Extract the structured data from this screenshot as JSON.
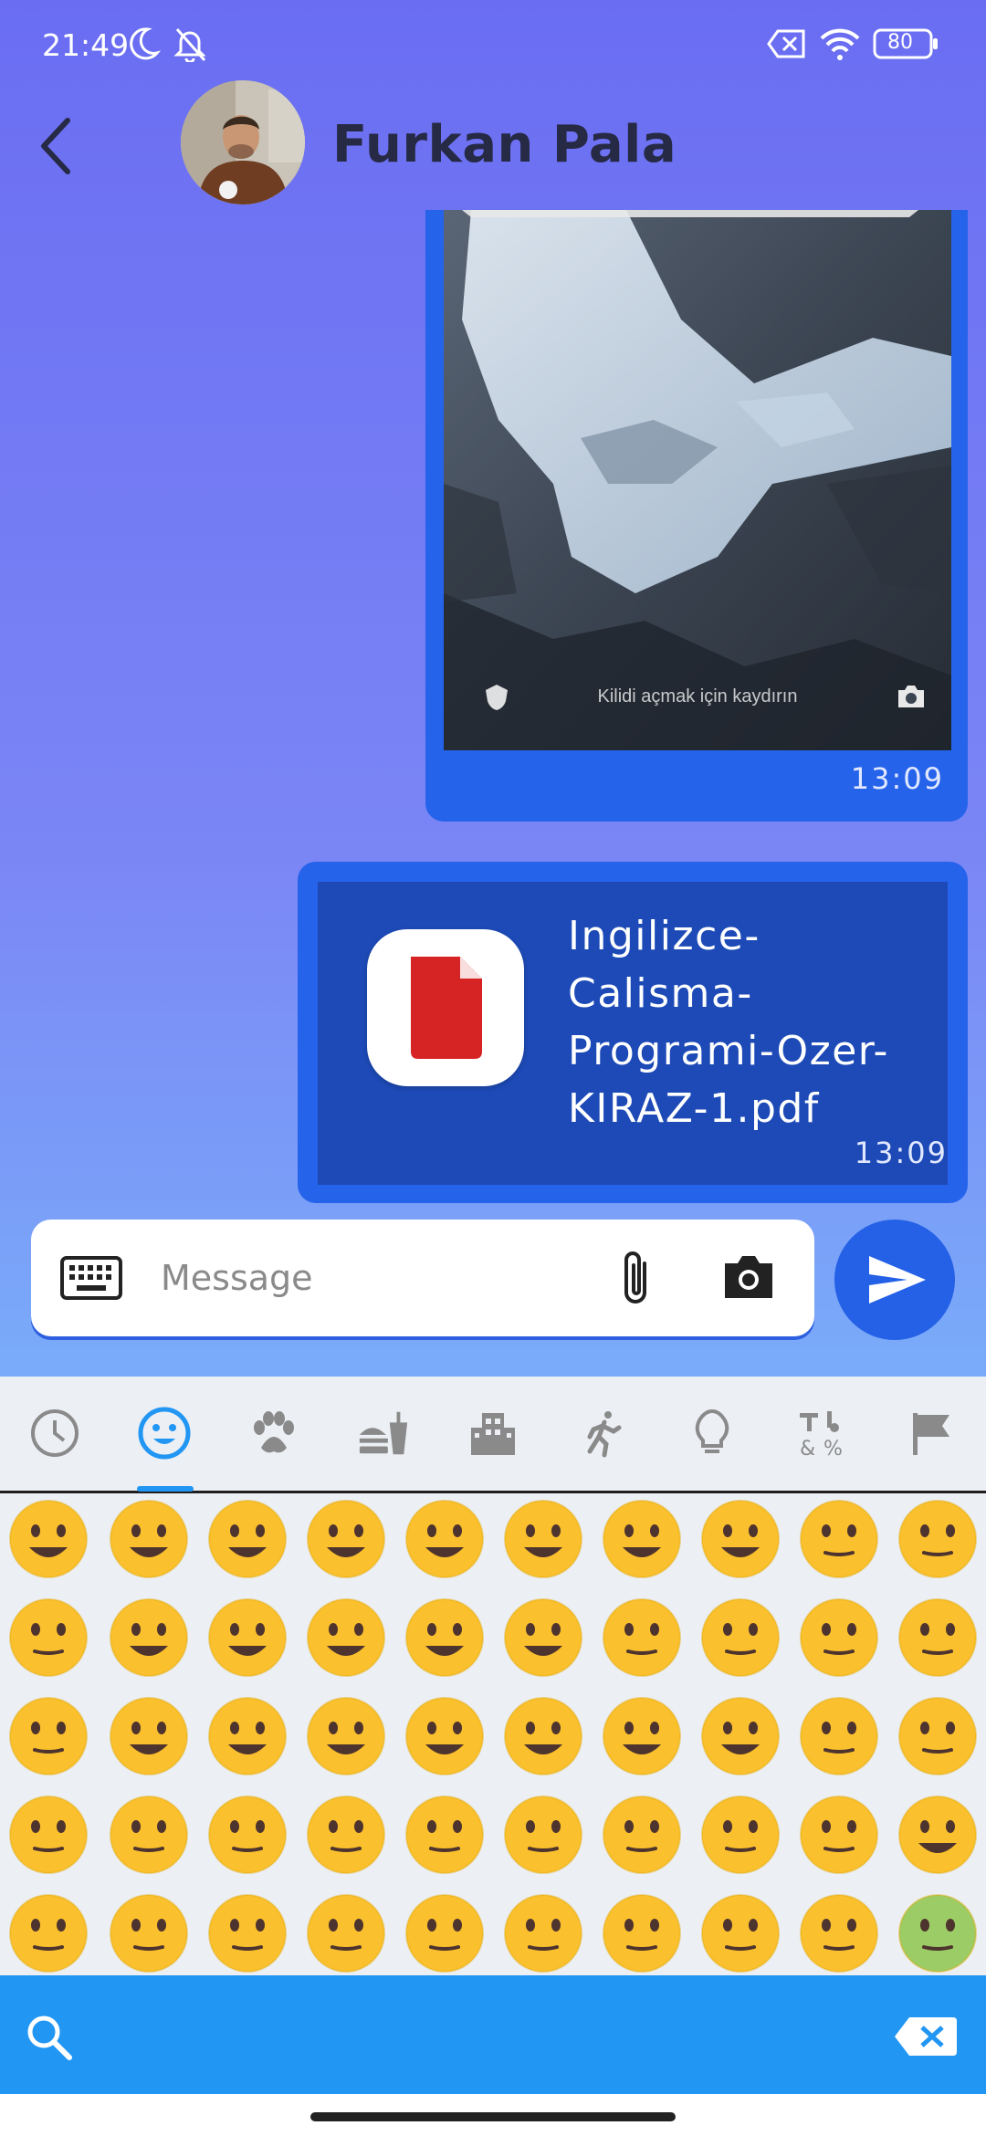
{
  "status_bar": {
    "time": "21:49",
    "battery": "80",
    "icons": [
      "moon-icon",
      "bell-off-icon",
      "sim-off-icon",
      "wifi-icon",
      "battery-icon"
    ]
  },
  "header": {
    "contact_name": "Furkan Pala",
    "back_icon": "chevron-left-icon"
  },
  "messages": [
    {
      "type": "image",
      "lock_hint": "Kilidi açmak için kaydırın",
      "time": "13:09"
    },
    {
      "type": "file",
      "file_name": "Ingilizce-Calisma-Programi-Ozer-KIRAZ-1.pdf",
      "file_name_lines": [
        "Ingilizce-",
        "Calisma-",
        "Programi-Ozer-",
        "KIRAZ-1.pdf"
      ],
      "time": "13:09"
    }
  ],
  "composer": {
    "placeholder": "Message",
    "value": ""
  },
  "emoji_keyboard": {
    "categories": [
      "recent",
      "smileys",
      "animals",
      "food",
      "travel",
      "activities",
      "objects",
      "symbols",
      "flags"
    ],
    "selected_category": "smileys",
    "accent_color": "#2196f3"
  },
  "colors": {
    "bubble": "#2563eb",
    "file_inner": "#1d4ab7",
    "send_button": "#2461e6",
    "accent": "#2196f3"
  }
}
